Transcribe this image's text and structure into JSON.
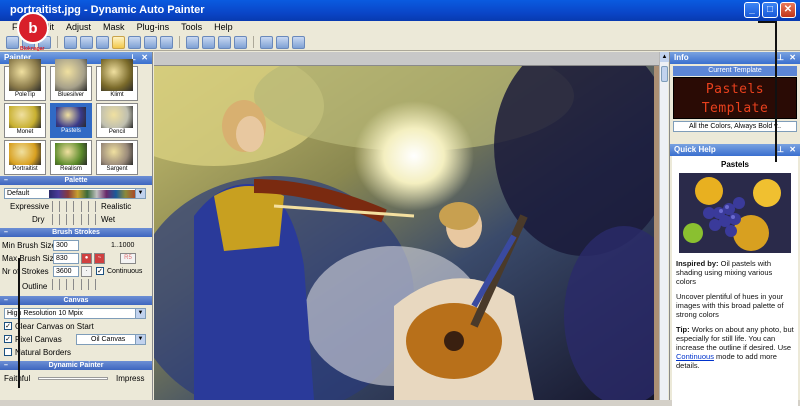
{
  "window": {
    "title": "portraitist.jpg - Dynamic Auto Painter",
    "controls": [
      "_",
      "□",
      "✕"
    ]
  },
  "menu": [
    "File",
    "Edit",
    "Adjust",
    "Mask",
    "Plug-ins",
    "Tools",
    "Help"
  ],
  "logo": {
    "glyph": "b",
    "text": "Bloknagar"
  },
  "left_panel": {
    "title": "Painter",
    "thumbnails": [
      {
        "label": "PoleTip",
        "color": "#8a7a4a"
      },
      {
        "label": "Bluesilver",
        "color": "#a6a08a"
      },
      {
        "label": "Klimt",
        "color": "#7a6a2a"
      },
      {
        "label": "Monet",
        "color": "#c8b030"
      },
      {
        "label": "Pastels",
        "color": "#3a3a8a"
      },
      {
        "label": "Pencil",
        "color": "#bfbfb0"
      },
      {
        "label": "Portraitist",
        "color": "#d8a020"
      },
      {
        "label": "Realism",
        "color": "#5a8a2a"
      },
      {
        "label": "Sargent",
        "color": "#9a8a7a"
      }
    ],
    "palette_section": "Palette",
    "palette_value": "Default",
    "expressive_left": "Expressive",
    "expressive_right": "Realistic",
    "dry_left": "Dry",
    "dry_right": "Wet",
    "brush_section": "Brush Strokes",
    "min_brush_label": "Min Brush Size",
    "min_brush_value": "300",
    "min_brush_side": "1..1000",
    "max_brush_label": "Max Brush Size",
    "max_brush_value": "830",
    "strokes_label": "Nr of Strokes",
    "strokes_value": "3600",
    "continuous_label": "Continuous",
    "outline_label": "Outline",
    "canvas_section": "Canvas",
    "canvas_value": "High Resolution 10 Mpix",
    "clear_canvas": "Clear Canvas on Start",
    "pixel_canvas": "Pixel Canvas",
    "oil_canvas": "Oil Canvas",
    "natural_borders": "Natural Borders",
    "dynamic_section": "Dynamic Painter",
    "faithful_left": "Faithful",
    "faithful_right": "Impress"
  },
  "right_panel": {
    "info_title": "Info",
    "current_template_label": "Current Template",
    "template_line1": "Pastels",
    "template_line2": "Template",
    "template_desc": "All the Colors, Always Bold v..",
    "quick_help_title": "Quick Help",
    "help_heading": "Pastels",
    "inspired_label": "Inspired by:",
    "inspired_text": "Oil pastels with shading using mixing various colors",
    "para2": "Uncover plentiful of hues in your images with this broad palette of strong colors",
    "tip_label": "Tip:",
    "tip_text": "Works on about any photo, but especially for still life. You can increase the outline if desired. Use",
    "tip_link": "Continuous",
    "tip_end": "mode to add more details."
  },
  "colors": {
    "titlebar": "#0a46c8",
    "panel_head": "#3a6fcf",
    "template_text": "#e8401d",
    "logo": "#d81f2a"
  }
}
